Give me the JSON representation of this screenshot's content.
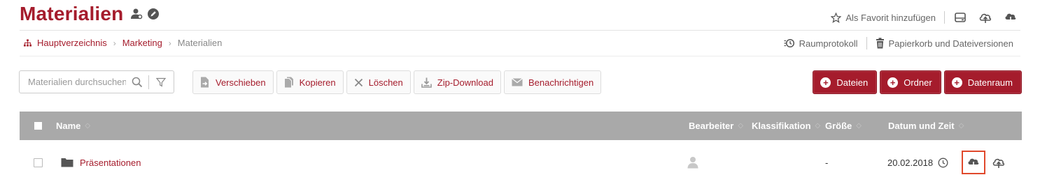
{
  "header": {
    "title": "Materialien",
    "favorite_label": "Als Favorit hinzufügen"
  },
  "breadcrumb": {
    "items": [
      "Hauptverzeichnis",
      "Marketing"
    ],
    "current": "Materialien"
  },
  "room_actions": {
    "protocol": "Raumprotokoll",
    "trash": "Papierkorb und Dateiversionen"
  },
  "search": {
    "placeholder": "Materialien durchsuchen"
  },
  "toolbar": {
    "move": "Verschieben",
    "copy": "Kopieren",
    "delete": "Löschen",
    "zip": "Zip-Download",
    "notify": "Benachrichtigen"
  },
  "create": {
    "files": "Dateien",
    "folder": "Ordner",
    "dataroom": "Datenraum"
  },
  "table": {
    "columns": {
      "name": "Name",
      "editor": "Bearbeiter",
      "classification": "Klassifikation",
      "size": "Größe",
      "datetime": "Datum und Zeit"
    },
    "rows": [
      {
        "name": "Präsentationen",
        "size": "-",
        "date": "20.02.2018"
      }
    ]
  },
  "colors": {
    "accent": "#a51c2c",
    "header_bg": "#a9a9a9",
    "highlight": "#e0492c"
  }
}
